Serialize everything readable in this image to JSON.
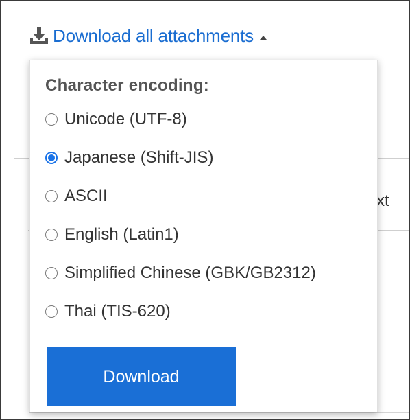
{
  "download_all": {
    "label": "Download all attachments",
    "icon": "download-icon",
    "caret_icon": "caret-up-icon",
    "color": "#1a6dd1"
  },
  "background": {
    "partial_text": "xt"
  },
  "encoding_popup": {
    "title": "Character encoding:",
    "selected": "Japanese (Shift-JIS)",
    "options": [
      {
        "label": "Unicode (UTF-8)",
        "checked": false
      },
      {
        "label": "Japanese (Shift-JIS)",
        "checked": true
      },
      {
        "label": "ASCII",
        "checked": false
      },
      {
        "label": "English (Latin1)",
        "checked": false
      },
      {
        "label": "Simplified Chinese (GBK/GB2312)",
        "checked": false
      },
      {
        "label": "Thai (TIS-620)",
        "checked": false
      }
    ],
    "download_button": "Download",
    "accent_color": "#1a6fd6"
  }
}
